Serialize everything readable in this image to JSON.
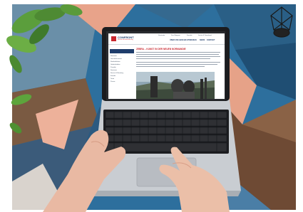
{
  "website": {
    "brand": "CONFRONT",
    "brand_sub": "Reisen der Erinnerung",
    "utility_links": [
      "Startseite",
      "Das Magazin",
      "Kontakt",
      "Suche & Download"
    ],
    "main_nav": [
      "ÜBER UNS",
      "GESCHICHTSREISEN",
      "NEWS",
      "KONTAKT"
    ],
    "sidebar_items": [
      "Startseite",
      "Geschichtsreisen",
      "Studienfahrten",
      "Gedenkstätten",
      "Projekte",
      "Seminare",
      "Service & Beratung",
      "Kontakt",
      "Team",
      "Presse"
    ],
    "article_title": "ZEBRA – KUNST IN DER NEUEN NORMANDIE"
  },
  "colors": {
    "brand_red": "#c8262e",
    "brand_navy": "#1e3d6b",
    "laptop_silver": "#c9cdd2",
    "keyboard_black": "#1c1d20"
  },
  "icons": [
    "plant-leaves",
    "geometric-wire-vase",
    "trackpad",
    "keyboard"
  ]
}
